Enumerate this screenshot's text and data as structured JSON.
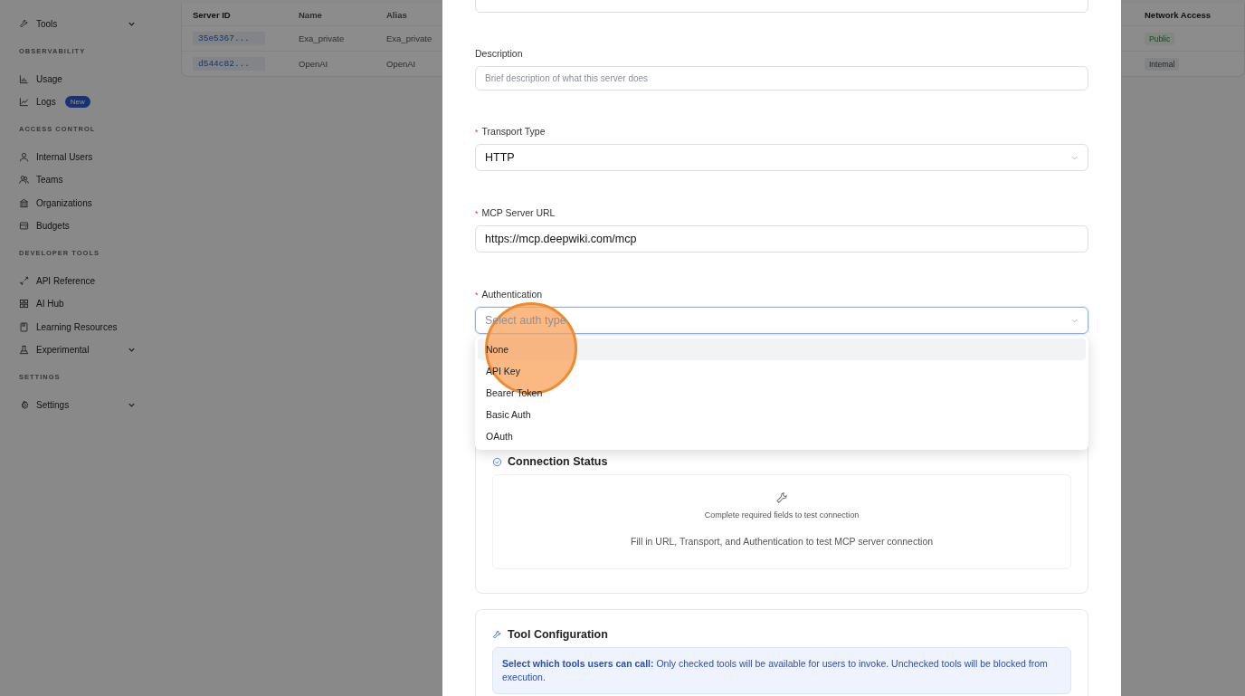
{
  "sidebar": {
    "sections": [
      {
        "items": [
          {
            "label": "Tools",
            "collapsible": true
          }
        ]
      },
      {
        "title": "OBSERVABILITY",
        "items": [
          {
            "label": "Usage",
            "collapsible": false
          },
          {
            "label": "Logs",
            "collapsible": false,
            "badge": "New"
          }
        ]
      },
      {
        "title": "ACCESS CONTROL",
        "items": [
          {
            "label": "Internal Users",
            "collapsible": false
          },
          {
            "label": "Teams",
            "collapsible": false
          },
          {
            "label": "Organizations",
            "collapsible": false
          },
          {
            "label": "Budgets",
            "collapsible": false
          }
        ]
      },
      {
        "title": "DEVELOPER TOOLS",
        "items": [
          {
            "label": "API Reference",
            "collapsible": false
          },
          {
            "label": "AI Hub",
            "collapsible": false
          },
          {
            "label": "Learning Resources",
            "collapsible": false
          },
          {
            "label": "Experimental",
            "collapsible": true
          }
        ]
      },
      {
        "title": "SETTINGS",
        "items": [
          {
            "label": "Settings",
            "collapsible": true
          }
        ]
      }
    ]
  },
  "table": {
    "columns": [
      "Server ID",
      "Name",
      "Alias",
      "Network Access"
    ],
    "rows": [
      {
        "server_id": "35e5367...",
        "name": "Exa_private",
        "alias": "Exa_private",
        "network_access": "Public",
        "kind": "positive"
      },
      {
        "server_id": "d544c82...",
        "name": "OpenAI",
        "alias": "OpenAI",
        "network_access": "Internal",
        "kind": "neutral"
      }
    ]
  },
  "modal": {
    "fields": [
      {
        "kind": "input",
        "label": "Description",
        "placeholder": "Brief description of what this server does",
        "focused": false
      },
      {
        "kind": "select",
        "label": "Transport Type",
        "required_mark": "*",
        "value": "HTTP",
        "focused": false
      },
      {
        "kind": "input",
        "label": "MCP Server URL",
        "required_mark": "*",
        "value": "https://mcp.deepwiki.com/mcp",
        "focused": false
      },
      {
        "kind": "select",
        "label": "Authentication",
        "required_mark": "*",
        "placeholder": "Select auth type",
        "focused": true
      }
    ],
    "dropdown": {
      "options": [
        {
          "label": "None",
          "selected": true
        },
        {
          "label": "API Key",
          "selected": false
        },
        {
          "label": "Bearer Token",
          "selected": false
        },
        {
          "label": "Basic Auth",
          "selected": false
        },
        {
          "label": "OAuth",
          "selected": false
        }
      ]
    },
    "connection_status": {
      "title": "Connection Status",
      "message": "Complete required fields to test connection",
      "hint": "Fill in URL, Transport, and Authentication to test MCP server connection"
    },
    "tool_configuration": {
      "title": "Tool Configuration",
      "note": "**Select which tools users can call:** Only checked tools will be available for users to invoke. Unchecked tools will be blocked from execution."
    }
  }
}
